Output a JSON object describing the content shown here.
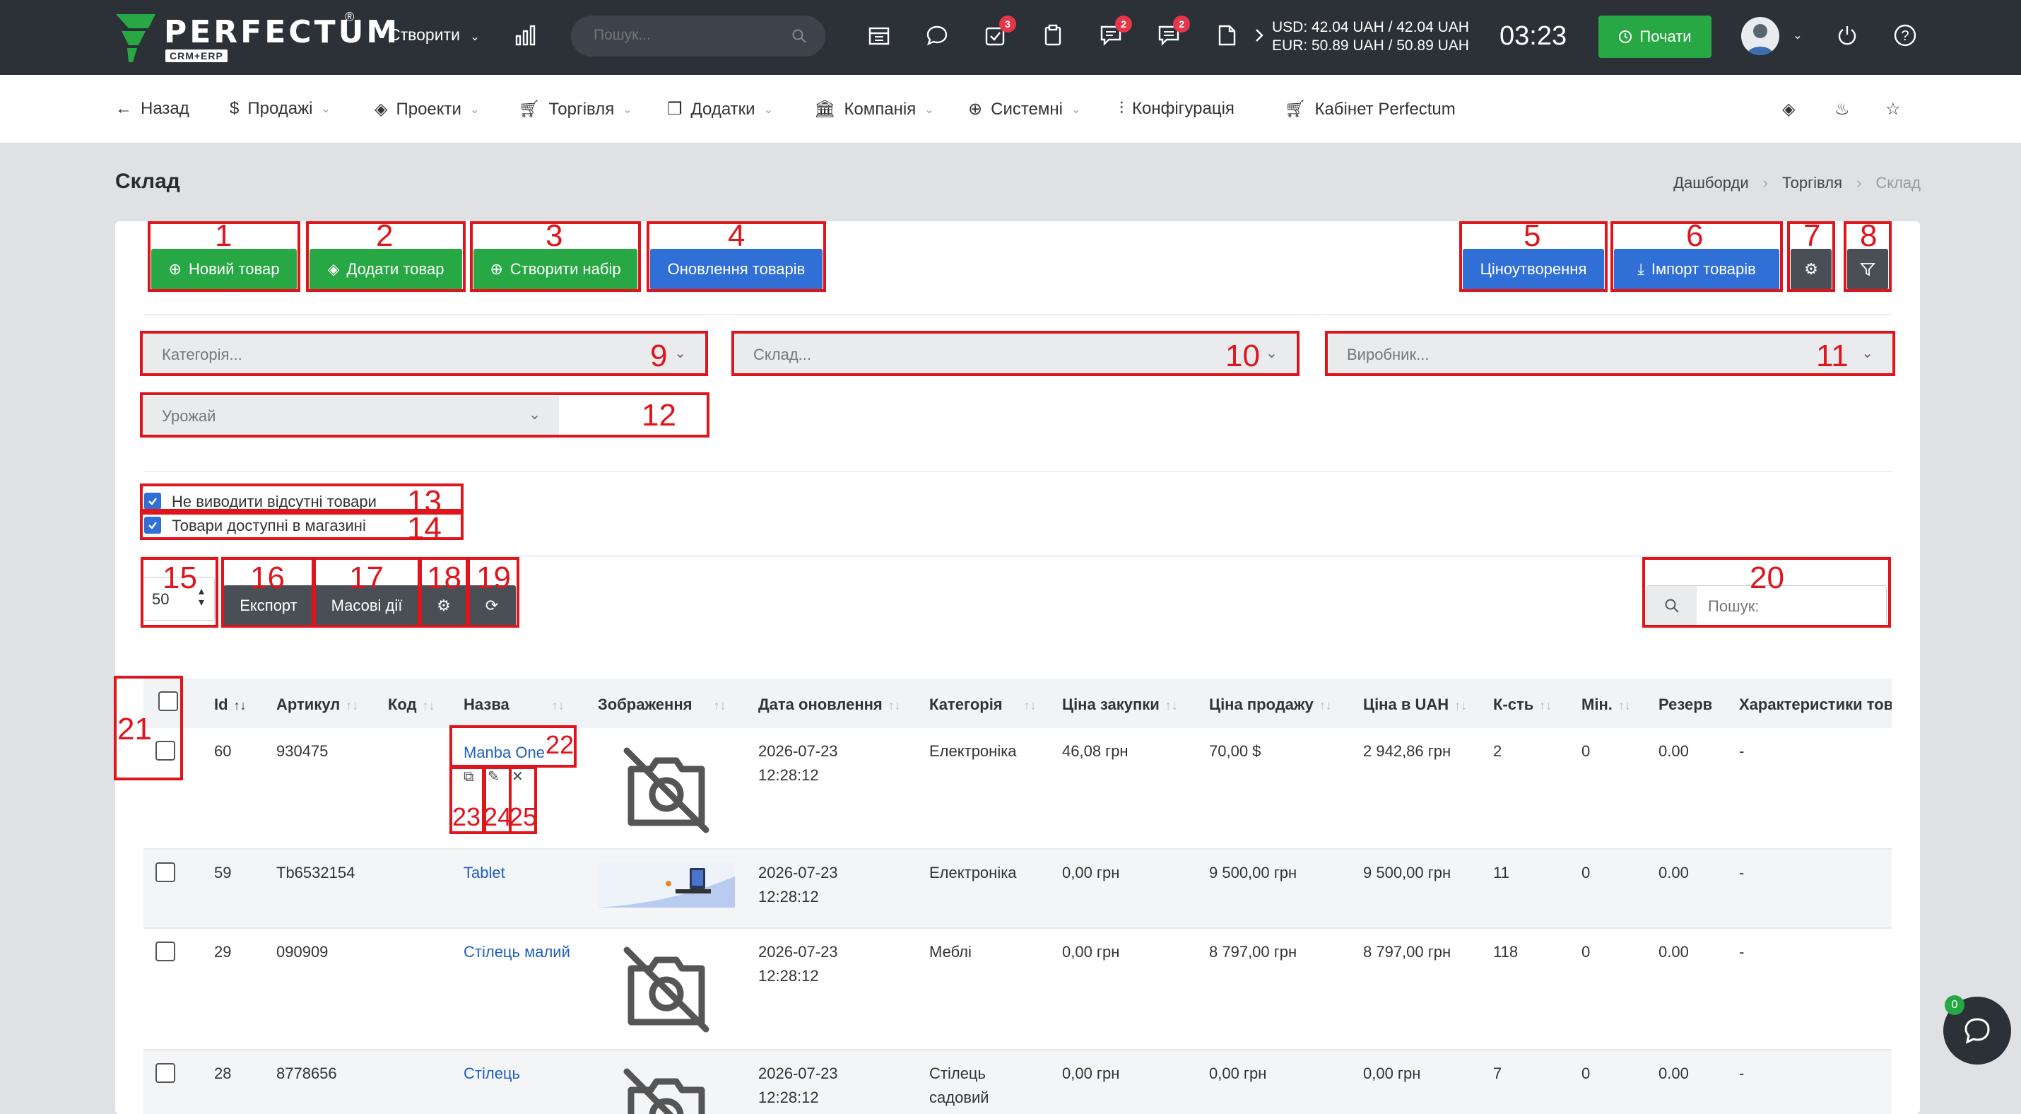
{
  "topbar": {
    "logo_text": "PERFECTUM",
    "logo_sub": "CRM+ERP",
    "logo_reg": "®",
    "create_label": "Створити",
    "search_placeholder": "Пошук...",
    "badges": {
      "tasks": "3",
      "messages": "2",
      "notes": "2"
    },
    "rates": {
      "usd": "USD: 42.04 UAH / 42.04 UAH",
      "eur": "EUR: 50.89 UAH / 50.89 UAH"
    },
    "clock": "03:23",
    "start_label": "Почати",
    "colors": {
      "bg": "#2b3137",
      "accent": "#27a844",
      "badge": "#e5374b"
    }
  },
  "menu": {
    "back": "Назад",
    "items": [
      "Продажі",
      "Проекти",
      "Торгівля",
      "Додатки",
      "Компанія",
      "Системні",
      "Конфігурація",
      "Кабінет Perfectum"
    ]
  },
  "page": {
    "title": "Склад",
    "breadcrumb": [
      "Дашборди",
      "Торгівля",
      "Склад"
    ]
  },
  "actions": {
    "new_product": "Новий товар",
    "add_product": "Додати товар",
    "create_set": "Створити набір",
    "update_products": "Оновлення товарів",
    "pricing": "Ціноутворення",
    "import_products": "Імпорт товарів"
  },
  "filters": {
    "category_placeholder": "Категорія...",
    "warehouse_placeholder": "Склад...",
    "manufacturer_placeholder": "Виробник...",
    "harvest_value": "Урожай",
    "hide_absent": "Не виводити відсутні товари",
    "available_in_store": "Товари доступні в магазині"
  },
  "toolbar": {
    "per_page": "50",
    "export": "Експорт",
    "bulk_actions": "Масові дії",
    "search_placeholder": "Пошук:"
  },
  "annotations": [
    "1",
    "2",
    "3",
    "4",
    "5",
    "6",
    "7",
    "8",
    "9",
    "10",
    "11",
    "12",
    "13",
    "14",
    "15",
    "16",
    "17",
    "18",
    "19",
    "20",
    "21",
    "22",
    "23",
    "24",
    "25"
  ],
  "table": {
    "columns": [
      "Id",
      "Артикул",
      "Код",
      "Назва",
      "Зображення",
      "Дата оновлення",
      "Категорія",
      "Ціна закупки",
      "Ціна продажу",
      "Ціна в UAH",
      "К-сть",
      "Мін.",
      "Резерв",
      "Характеристики тов"
    ],
    "rows": [
      {
        "id": "60",
        "sku": "930475",
        "code": "",
        "name": "Manba One",
        "date": "2026-07-23",
        "time": "12:28:12",
        "category": "Електроніка",
        "category2": "",
        "buy": "46,08 грн",
        "sell": "70,00 $",
        "uah": "2 942,86 грн",
        "qty": "2",
        "min": "0",
        "reserve": "0.00",
        "chars": "-"
      },
      {
        "id": "59",
        "sku": "Tb6532154",
        "code": "",
        "name": "Tablet",
        "date": "2026-07-23",
        "time": "12:28:12",
        "category": "Електроніка",
        "category2": "",
        "buy": "0,00 грн",
        "sell": "9 500,00 грн",
        "uah": "9 500,00 грн",
        "qty": "11",
        "min": "0",
        "reserve": "0.00",
        "chars": "-"
      },
      {
        "id": "29",
        "sku": "090909",
        "code": "",
        "name": "Стілець малий",
        "date": "2026-07-23",
        "time": "12:28:12",
        "category": "Меблі",
        "category2": "",
        "buy": "0,00 грн",
        "sell": "8 797,00 грн",
        "uah": "8 797,00 грн",
        "qty": "118",
        "min": "0",
        "reserve": "0.00",
        "chars": "-"
      },
      {
        "id": "28",
        "sku": "8778656",
        "code": "",
        "name": "Стілець",
        "date": "2026-07-23",
        "time": "12:28:12",
        "category": "Стілець",
        "category2": "садовий",
        "buy": "0,00 грн",
        "sell": "0,00 грн",
        "uah": "0,00 грн",
        "qty": "7",
        "min": "0",
        "reserve": "0.00",
        "chars": "-"
      }
    ]
  },
  "chat": {
    "badge": "0"
  }
}
